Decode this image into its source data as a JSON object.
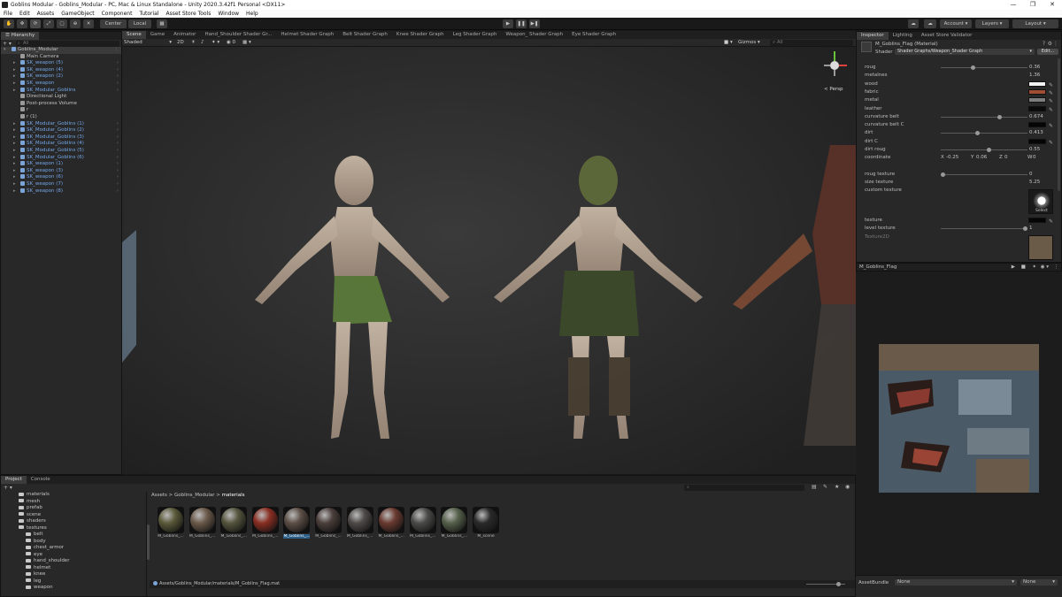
{
  "window": {
    "title": "Goblins Modular - Goblins_Modular - PC, Mac & Linux Standalone - Unity 2020.3.42f1 Personal <DX11>",
    "controls": [
      "—",
      "❐",
      "✕"
    ]
  },
  "menu": [
    "File",
    "Edit",
    "Assets",
    "GameObject",
    "Component",
    "Tutorial",
    "Asset Store Tools",
    "Window",
    "Help"
  ],
  "toolbar": {
    "pivot_label": "Center",
    "space_label": "Local",
    "account_label": "Account",
    "layers_label": "Layers",
    "layout_label": "Layout"
  },
  "hierarchy": {
    "tab": "Hierarchy",
    "search_placeholder": "All",
    "rows": [
      {
        "label": "Goblins_Modular",
        "kind": "scene",
        "indent": 0
      },
      {
        "label": "Main Camera",
        "kind": "plain",
        "indent": 1
      },
      {
        "label": "SK_weapon (5)",
        "kind": "prefab",
        "indent": 1
      },
      {
        "label": "SK_weapon (4)",
        "kind": "prefab",
        "indent": 1
      },
      {
        "label": "SK_weapon (2)",
        "kind": "prefab",
        "indent": 1
      },
      {
        "label": "SK_weapon",
        "kind": "prefab",
        "indent": 1
      },
      {
        "label": "SK_Modular_Goblins",
        "kind": "prefab",
        "indent": 1
      },
      {
        "label": "Directional Light",
        "kind": "plain",
        "indent": 1
      },
      {
        "label": "Post-process Volume",
        "kind": "plain",
        "indent": 1
      },
      {
        "label": "r",
        "kind": "plain",
        "indent": 1
      },
      {
        "label": "r (1)",
        "kind": "plain",
        "indent": 1
      },
      {
        "label": "SK_Modular_Goblins (1)",
        "kind": "prefab",
        "indent": 1
      },
      {
        "label": "SK_Modular_Goblins (2)",
        "kind": "prefab",
        "indent": 1
      },
      {
        "label": "SK_Modular_Goblins (3)",
        "kind": "prefab",
        "indent": 1
      },
      {
        "label": "SK_Modular_Goblins (4)",
        "kind": "prefab",
        "indent": 1
      },
      {
        "label": "SK_Modular_Goblins (5)",
        "kind": "prefab",
        "indent": 1
      },
      {
        "label": "SK_Modular_Goblins (6)",
        "kind": "prefab",
        "indent": 1
      },
      {
        "label": "SK_weapon (1)",
        "kind": "prefab",
        "indent": 1
      },
      {
        "label": "SK_weapon (3)",
        "kind": "prefab",
        "indent": 1
      },
      {
        "label": "SK_weapon (6)",
        "kind": "prefab",
        "indent": 1
      },
      {
        "label": "SK_weapon (7)",
        "kind": "prefab",
        "indent": 1
      },
      {
        "label": "SK_weapon (8)",
        "kind": "prefab",
        "indent": 1
      }
    ]
  },
  "center_tabs": [
    "Scene",
    "Game",
    "Animator",
    "Hand_Shoulder Shader Gr...",
    "Helmet Shader Graph",
    "Belt Shader Graph",
    "Knee Shader Graph",
    "Leg Shader Graph",
    "Weapon_ Shader Graph",
    "Eye Shader Graph"
  ],
  "scene_toolbar": {
    "shading_mode": "Shaded",
    "mode_2d": "2D",
    "gizmos_label": "Gizmos",
    "search_placeholder": "All",
    "persp_label": "< Persp"
  },
  "inspector": {
    "tabs": [
      "Inspector",
      "Lighting",
      "Asset Store Validator"
    ],
    "material_name": "M_Goblins_Flag (Material)",
    "shader_label": "Shader",
    "shader_value": "Shader Graphs/Weapon_Shader Graph",
    "edit_label": "Edit...",
    "properties": [
      {
        "label": "roug",
        "type": "slider",
        "value": "0.36",
        "fraction": 0.36
      },
      {
        "label": "metalnes",
        "type": "value",
        "value": "1.36"
      },
      {
        "label": "wood",
        "type": "color",
        "color": "#f2f2f2"
      },
      {
        "label": "fabric",
        "type": "color",
        "color": "#a04d34"
      },
      {
        "label": "metal",
        "type": "color",
        "color": "#7d7d7d"
      },
      {
        "label": "leather",
        "type": "color",
        "color": "#0a0a0a"
      },
      {
        "label": "curvature belt",
        "type": "slider",
        "value": "0.674",
        "fraction": 0.674
      },
      {
        "label": "curvature belt C",
        "type": "color",
        "color": "#050505"
      },
      {
        "label": "dirt",
        "type": "slider",
        "value": "0.413",
        "fraction": 0.413
      },
      {
        "label": "dirt C",
        "type": "color",
        "color": "#050505"
      },
      {
        "label": "dirt roug",
        "type": "slider",
        "value": "0.55",
        "fraction": 0.55
      },
      {
        "label": "coordinate",
        "type": "vector",
        "x": "-0.25",
        "y": "0.06",
        "z": "0",
        "w": "0"
      }
    ],
    "properties2": [
      {
        "label": "roug texture",
        "type": "slider",
        "value": "0",
        "fraction": 0.0
      },
      {
        "label": "size texture",
        "type": "value",
        "value": "5.25"
      },
      {
        "label": "custom texture",
        "type": "texture",
        "select": "Select"
      },
      {
        "label": "texture",
        "type": "color",
        "color": "#050505"
      },
      {
        "label": "level texture",
        "type": "slider",
        "value": "1",
        "fraction": 0.98
      }
    ],
    "texture2d_label": "Texture2D"
  },
  "preview": {
    "title": "M_Goblins_Flag"
  },
  "assetbundle": {
    "label": "AssetBundle",
    "value": "None",
    "variant": "None"
  },
  "project": {
    "tabs": [
      "Project",
      "Console"
    ],
    "tree": [
      {
        "label": "materials",
        "indent": 1
      },
      {
        "label": "mesh",
        "indent": 1
      },
      {
        "label": "prefab",
        "indent": 1
      },
      {
        "label": "scene",
        "indent": 1
      },
      {
        "label": "shaders",
        "indent": 1
      },
      {
        "label": "textures",
        "indent": 1
      },
      {
        "label": "belt",
        "indent": 2
      },
      {
        "label": "body",
        "indent": 2
      },
      {
        "label": "chest_armor",
        "indent": 2
      },
      {
        "label": "eye",
        "indent": 2
      },
      {
        "label": "hand_shoulder",
        "indent": 2
      },
      {
        "label": "helmet",
        "indent": 2
      },
      {
        "label": "knee",
        "indent": 2
      },
      {
        "label": "leg",
        "indent": 2
      },
      {
        "label": "weapon",
        "indent": 2
      }
    ],
    "breadcrumb": [
      "Assets",
      "Goblins_Modular",
      "materials"
    ],
    "assets": [
      {
        "name": "M_Goblins_...",
        "color": "#5b5a3a",
        "selected": false
      },
      {
        "name": "M_Goblins_...",
        "color": "#6b5a4a",
        "selected": false
      },
      {
        "name": "M_Goblins_...",
        "color": "#55553e",
        "selected": false
      },
      {
        "name": "M_Goblins_...",
        "color": "#8a2e22",
        "selected": false
      },
      {
        "name": "M_Goblins_...",
        "color": "#5c4e46",
        "selected": true
      },
      {
        "name": "M_Goblins_...",
        "color": "#4a3e3a",
        "selected": false
      },
      {
        "name": "M_Goblins_...",
        "color": "#4e4a48",
        "selected": false
      },
      {
        "name": "M_Goblins_...",
        "color": "#6a3a30",
        "selected": false
      },
      {
        "name": "M_Goblins_...",
        "color": "#4b4b48",
        "selected": false
      },
      {
        "name": "M_Goblins_...",
        "color": "#55604a",
        "selected": false
      },
      {
        "name": "M_scene",
        "color": "#2a2a2a",
        "selected": false
      }
    ],
    "footer_path": "Assets/Goblins_Modular/materials/M_Goblins_Flag.mat"
  }
}
